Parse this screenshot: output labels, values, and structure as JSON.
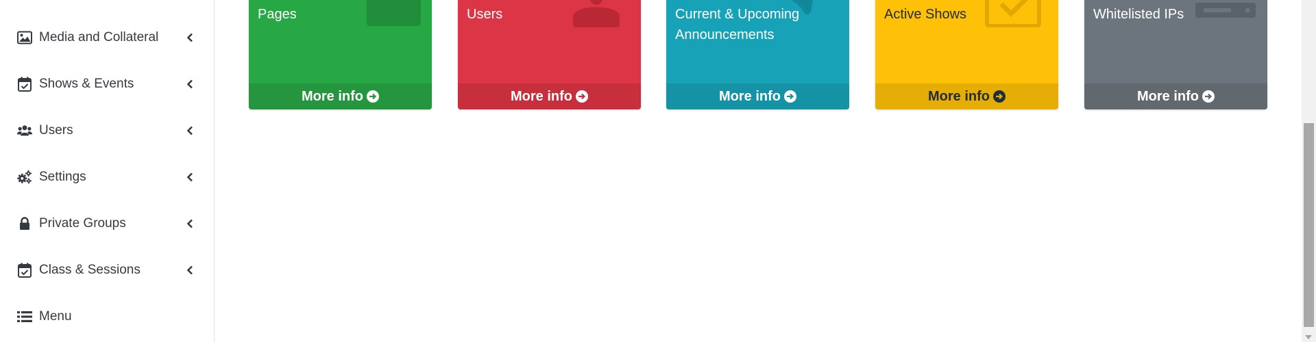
{
  "sidebar": {
    "items": [
      {
        "label": "Media and Collateral",
        "icon": "image-icon"
      },
      {
        "label": "Shows & Events",
        "icon": "calendar-check-icon"
      },
      {
        "label": "Users",
        "icon": "users-icon"
      },
      {
        "label": "Settings",
        "icon": "cogs-icon"
      },
      {
        "label": "Private Groups",
        "icon": "lock-icon"
      },
      {
        "label": "Class & Sessions",
        "icon": "calendar-check-icon"
      },
      {
        "label": "Menu",
        "icon": "list-icon"
      }
    ]
  },
  "cards": [
    {
      "title": "Pages",
      "footer": "More info",
      "color": "#28a745",
      "footer_color": "#25963f",
      "icon": "file-icon"
    },
    {
      "title": "Users",
      "footer": "More info",
      "color": "#dc3545",
      "footer_color": "#c82f3d",
      "icon": "user-icon"
    },
    {
      "title": "Current & Upcoming Announcements",
      "footer": "More info",
      "color": "#17a2b8",
      "footer_color": "#1592a6",
      "icon": "bullhorn-icon"
    },
    {
      "title": "Active Shows",
      "footer": "More info",
      "color": "#ffc107",
      "footer_color": "#e6ad06",
      "icon": "check-square-icon"
    },
    {
      "title": "Whitelisted IPs",
      "footer": "More info",
      "color": "#6c757d",
      "footer_color": "#61696f",
      "icon": "server-icon"
    }
  ]
}
